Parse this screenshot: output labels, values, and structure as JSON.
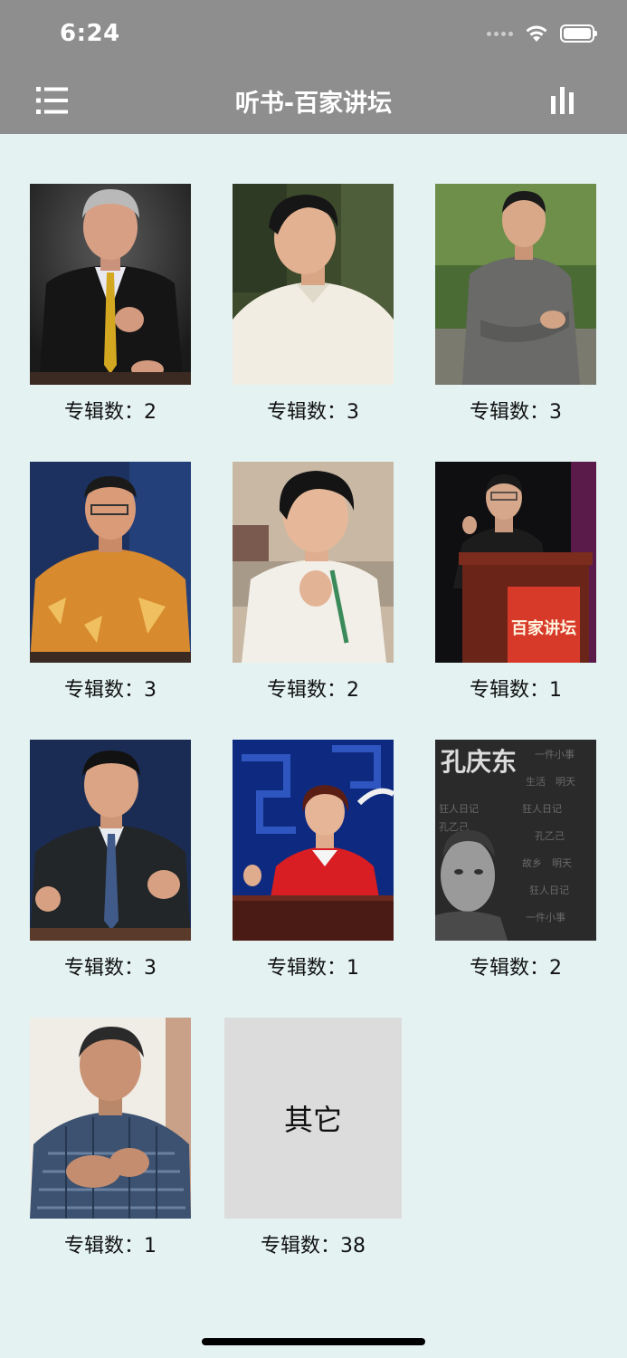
{
  "status_bar": {
    "time": "6:24"
  },
  "nav": {
    "title": "听书-百家讲坛",
    "left_icon": "list-icon",
    "right_icon": "bar-chart-icon"
  },
  "colors": {
    "nav_background": "#8e8e8e",
    "page_background": "#e4f3f2",
    "other_tile_background": "#dcdcdc"
  },
  "speakers": [
    {
      "caption": "专辑数：2"
    },
    {
      "caption": "专辑数：3"
    },
    {
      "caption": "专辑数：3"
    },
    {
      "caption": "专辑数：3"
    },
    {
      "caption": "专辑数：2"
    },
    {
      "caption": "专辑数：1",
      "podium_text": "百家讲坛"
    },
    {
      "caption": "专辑数：3"
    },
    {
      "caption": "专辑数：1"
    },
    {
      "caption": "专辑数：2",
      "poster_title": "孔庆东"
    },
    {
      "caption": "专辑数：1"
    }
  ],
  "other": {
    "label": "其它",
    "caption": "专辑数：38"
  }
}
